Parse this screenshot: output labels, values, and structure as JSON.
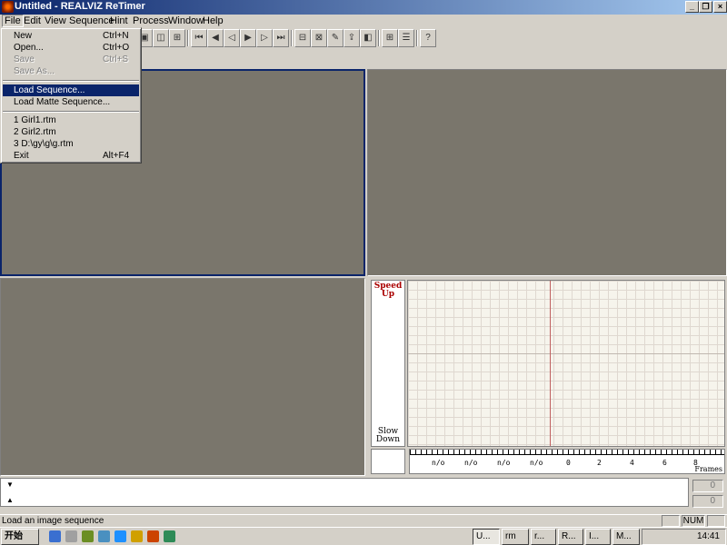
{
  "window": {
    "title": "Untitled - REALVIZ ReTimer",
    "controls": [
      "_",
      "❐",
      "×"
    ]
  },
  "menubar": [
    "File",
    "Edit",
    "View",
    "Sequence",
    "Hint",
    "Process",
    "Window",
    "Help"
  ],
  "file_menu": {
    "items": [
      {
        "label": "New",
        "shortcut": "Ctrl+N"
      },
      {
        "label": "Open...",
        "shortcut": "Ctrl+O"
      },
      {
        "label": "Save",
        "shortcut": "Ctrl+S"
      },
      {
        "label": "Save As...",
        "shortcut": ""
      },
      {
        "label": "Load Sequence...",
        "shortcut": ""
      },
      {
        "label": "Load Matte Sequence...",
        "shortcut": ""
      },
      {
        "label": "1 Girl1.rtm",
        "shortcut": ""
      },
      {
        "label": "2 Girl2.rtm",
        "shortcut": ""
      },
      {
        "label": "3 D:\\gy\\g\\g.rtm",
        "shortcut": ""
      },
      {
        "label": "Exit",
        "shortcut": "Alt+F4"
      }
    ]
  },
  "toolbar": {
    "icons": [
      "layout-single-icon",
      "layout-split-icon",
      "layout-grid-icon",
      "go-start-icon",
      "step-back-icon",
      "play-back-icon",
      "play-icon",
      "step-forward-icon",
      "go-end-icon",
      "process-icon",
      "process-all-icon",
      "hint-icon",
      "export-icon",
      "render-icon",
      "grid-view-icon",
      "list-view-icon",
      "help-icon"
    ],
    "glyphs": [
      "▣",
      "◫",
      "⊞",
      "⏮",
      "◀",
      "◁",
      "▶",
      "▷",
      "⏭",
      "⊟",
      "⊠",
      "✎",
      "⇪",
      "◧",
      "⊞",
      "☰",
      "?"
    ]
  },
  "graph": {
    "speed_up": [
      "Speed",
      "Up"
    ],
    "slow_down": [
      "Slow",
      "Down"
    ],
    "frames_label": "Frames",
    "ruler_labels": [
      "n/o",
      "n/o",
      "n/o",
      "n/o",
      "0",
      "2",
      "4",
      "6",
      "8"
    ]
  },
  "timeline": {
    "counter_top": "0",
    "counter_bottom": "0"
  },
  "status": {
    "message": "Load an image sequence",
    "num": "NUM"
  },
  "taskbar": {
    "start_label": "开始",
    "tasks": [
      "U...",
      "rm",
      "r...",
      "R...",
      "I...",
      "M..."
    ],
    "clock": "14:41"
  },
  "colors": {
    "title_bar": "#0a246a",
    "highlight": "#0a246a",
    "viewport": "#7a766c",
    "speed_up": "#aa0000"
  }
}
